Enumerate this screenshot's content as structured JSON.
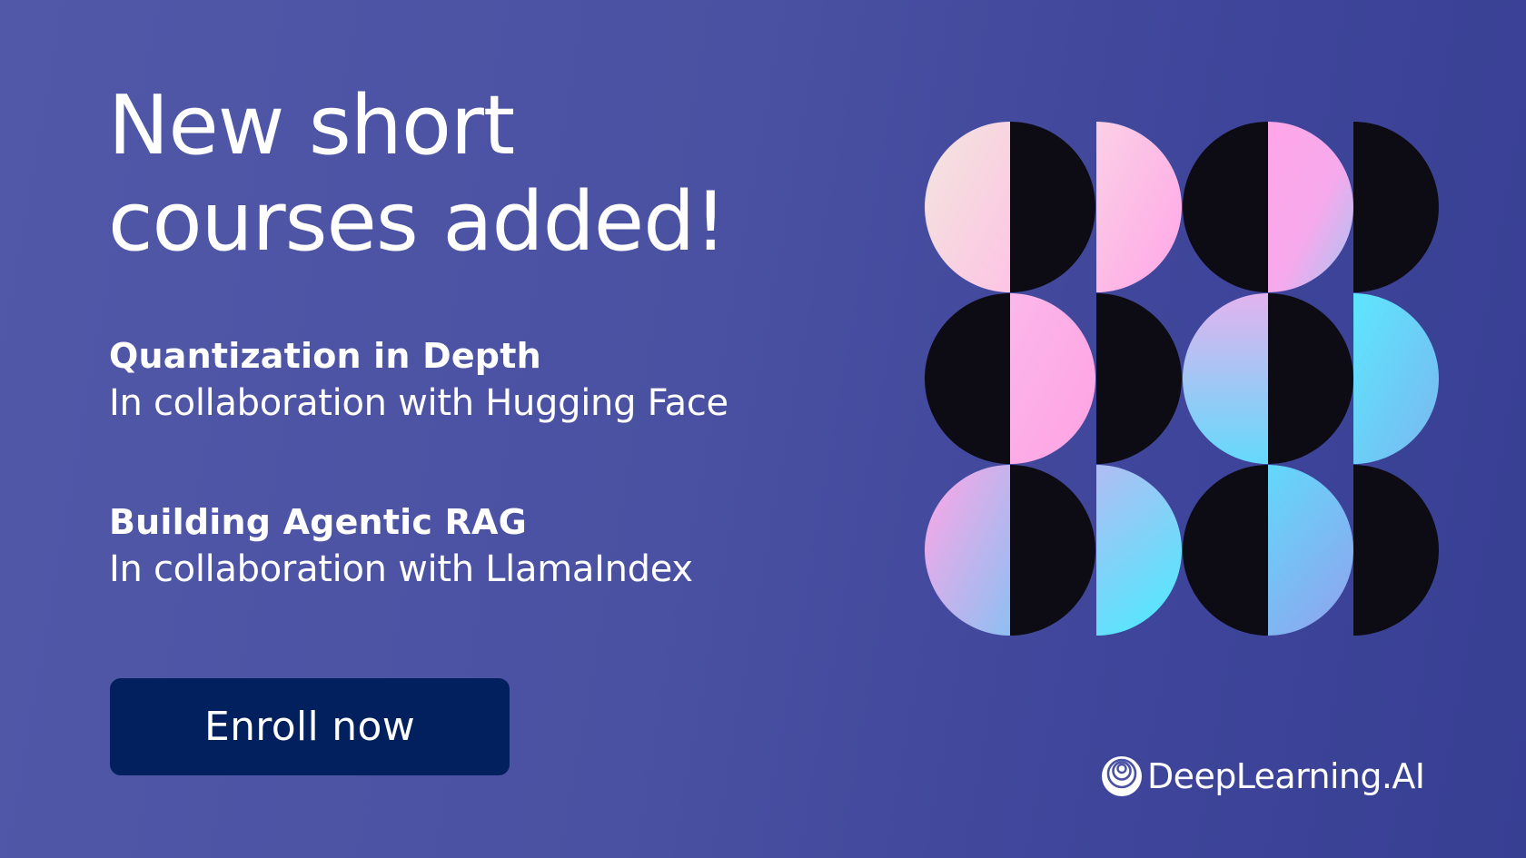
{
  "headline": {
    "line1": "New short",
    "line2": "courses added!"
  },
  "courses": [
    {
      "title": "Quantization in Depth",
      "partner": "In collaboration with Hugging Face"
    },
    {
      "title": "Building Agentic RAG",
      "partner": "In collaboration with LlamaIndex"
    }
  ],
  "cta": {
    "label": "Enroll now"
  },
  "brand": {
    "name": "DeepLearning.AI",
    "icon": "deeplearning-ai-logo-icon"
  },
  "colors": {
    "background_start": "#5258a8",
    "background_end": "#373f93",
    "button": "#01205d",
    "text": "#ffffff",
    "art_dark": "#0d0c14",
    "art_pink": "#ffa9e6",
    "art_cream": "#f5e0dc",
    "art_cyan": "#5fe3fd",
    "art_periwinkle": "#8fb2f1"
  }
}
